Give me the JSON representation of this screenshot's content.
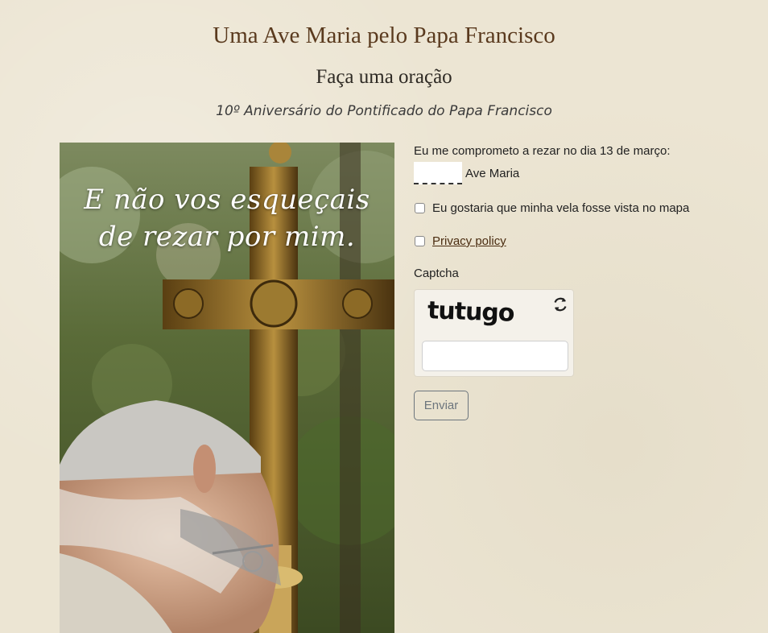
{
  "header": {
    "title": "Uma Ave Maria pelo Papa Francisco",
    "subtitle": "Faça uma oração",
    "tagline": "10º Aniversário do Pontificado do Papa Francisco"
  },
  "image": {
    "quote_line1": "E não vos esqueçais",
    "quote_line2": "de rezar por mim."
  },
  "form": {
    "pledge_label": "Eu me comprometo a rezar no dia 13 de março:",
    "count_value": "",
    "count_unit": "Ave Maria",
    "map_checkbox_label": "Eu gostaria que minha vela fosse vista no mapa",
    "map_checked": false,
    "privacy_label": "Privacy policy",
    "privacy_checked": false,
    "captcha_label": "Captcha",
    "captcha_text": "tutugo",
    "captcha_value": "",
    "submit_label": "Enviar"
  },
  "colors": {
    "background": "#ece5d3",
    "title": "#5a3a1e",
    "link": "#4a2c10",
    "button_border": "#6c757d"
  },
  "icons": {
    "refresh": "refresh-icon"
  }
}
